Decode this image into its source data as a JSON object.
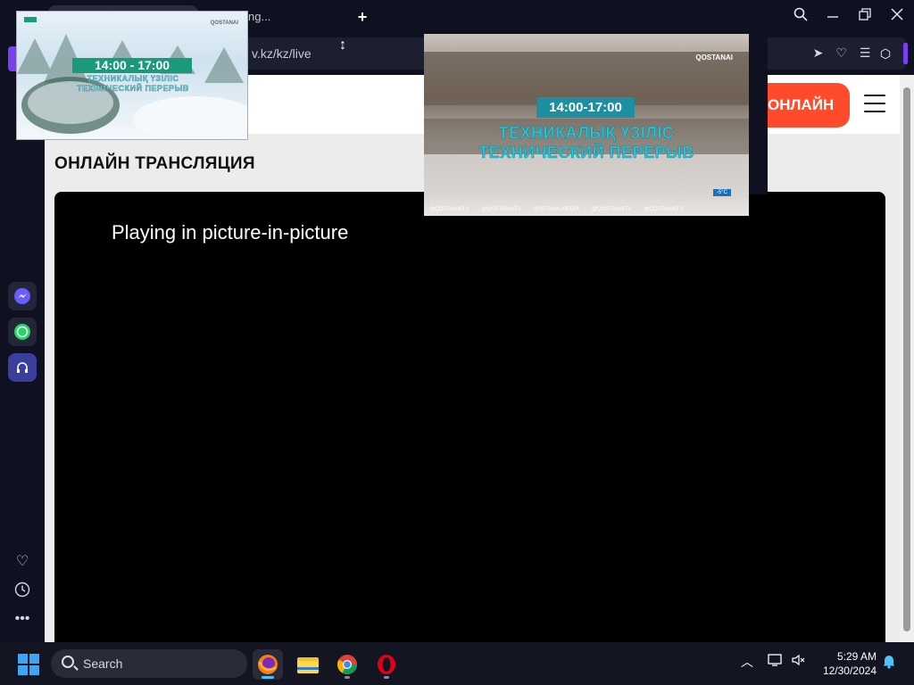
{
  "browser": {
    "tab_title_partial": "ng...",
    "url": "v.kz/kz/live",
    "new_tab_symbol": "+",
    "window_controls": [
      "search-icon",
      "minimize-icon",
      "restore-icon",
      "close-icon"
    ],
    "address_icons": [
      "share-icon",
      "heart-icon",
      "sliders-icon",
      "profile-icon"
    ],
    "extension_icon": "cube-icon"
  },
  "sidebar": {
    "apps": [
      "messenger-icon",
      "whatsapp-icon",
      "music-icon"
    ],
    "bottom_icons": [
      "heart-icon",
      "history-icon",
      "more-icon"
    ]
  },
  "site": {
    "online_button": "ОНЛАЙН",
    "menu_icon": "hamburger-icon",
    "page_title": "ОНЛАЙН ТРАНСЛЯЦИЯ",
    "player_message": "Playing in picture-in-picture"
  },
  "pip_small": {
    "time": "14:00 - 17:00",
    "kazakh_text": "ТЕХНИКАЛЫҚ ҮЗІЛІС",
    "russian_text": "ТЕХНИЧЕСКИЙ ПЕРЕРЫВ",
    "brand": "QOSTANAI"
  },
  "pip_big": {
    "time": "14:00-17:00",
    "kazakh_text": "ТЕХНИКАЛЫҚ ҮЗІЛІС",
    "russian_text": "ТЕХНИЧЕСКИЙ ПЕРЕРЫВ",
    "brand": "QOSTANAI",
    "temperature": "-5°C",
    "socials": [
      "@QOSTANAITV",
      "@QOSTANAITV",
      "QOSTANAI.MEDIA",
      "@QOSTANAITV",
      "@QOSTANAITV"
    ]
  },
  "taskbar": {
    "search_label": "Search",
    "apps": [
      "firefox-icon",
      "file-explorer-icon",
      "chrome-icon",
      "opera-icon"
    ],
    "time": "5:29 AM",
    "date": "12/30/2024"
  },
  "colors": {
    "accent_purple": "#7b3ff2",
    "online_red": "#ff4b2b",
    "badge_teal": "#1a9a7a",
    "text_cyan": "#22c6da"
  }
}
